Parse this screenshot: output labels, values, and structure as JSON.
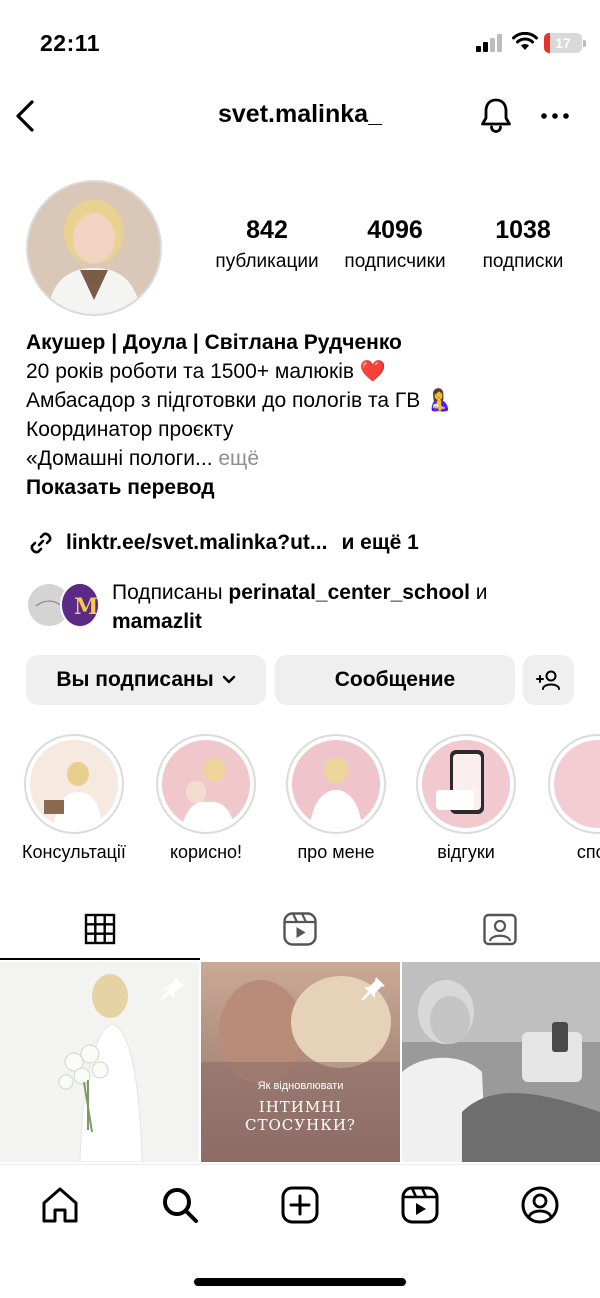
{
  "status": {
    "time": "22:11",
    "battery": "17",
    "battery_level": 0.17
  },
  "header": {
    "username": "svet.malinka_"
  },
  "profile": {
    "stats": {
      "posts_num": "842",
      "posts_label": "публикации",
      "followers_num": "4096",
      "followers_label": "подписчики",
      "following_num": "1038",
      "following_label": "подписки"
    },
    "bio": {
      "name": "Акушер | Доула | Світлана Рудченко",
      "line1": "20 років роботи та 1500+ малюків ❤️",
      "line2": "Амбасадор з підготовки до пологів та ГВ 🤱",
      "line3": "Координатор проєкту",
      "line4": "«Домашні пологи...",
      "more": " ещё",
      "translate": "Показать перевод"
    },
    "link": {
      "url": "linktr.ee/svet.malinka?ut...",
      "more": "и ещё 1"
    },
    "mutual": {
      "prefix": "Подписаны ",
      "user1": "perinatal_center_school",
      "joiner": " и ",
      "user2": "mamazlit"
    }
  },
  "buttons": {
    "following": "Вы подписаны",
    "message": "Сообщение"
  },
  "highlights": [
    {
      "label": "Консультації"
    },
    {
      "label": "корисно!"
    },
    {
      "label": "про мене"
    },
    {
      "label": "відгуки"
    },
    {
      "label": "сповi"
    }
  ],
  "posts": [
    {
      "pinned": true
    },
    {
      "pinned": true,
      "text_small": "Як відновлювати",
      "text_big1": "ІНТИМНІ",
      "text_big2": "СТОСУНКИ?"
    },
    {
      "pinned": false
    }
  ],
  "icons": {
    "back": "chevron-left-icon",
    "bell": "bell-icon",
    "more": "more-horizontal-icon",
    "link": "link-icon",
    "add_user": "add-user-icon",
    "grid": "grid-icon",
    "reels": "reels-icon",
    "tagged": "tagged-icon",
    "home": "home-icon",
    "search": "search-icon",
    "create": "create-icon",
    "nav_reels": "reels-icon",
    "profile": "profile-icon"
  },
  "colors": {
    "link": "#00376b",
    "muted": "#8e8e8e",
    "button_bg": "#efefef",
    "battery_low": "#e5342b"
  }
}
